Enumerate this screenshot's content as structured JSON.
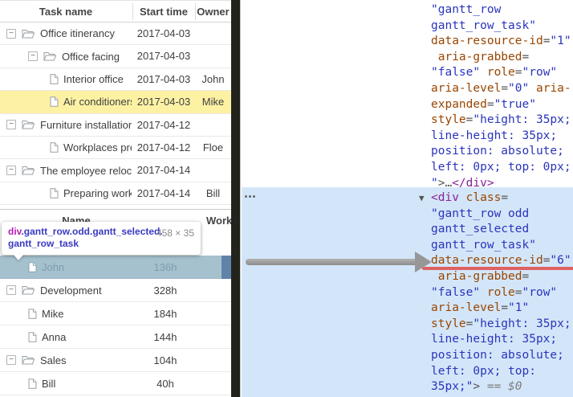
{
  "icons": {
    "collapse_glyph": "−",
    "overflow_marker": "⋯"
  },
  "left_panel": {
    "task_grid": {
      "columns": [
        "Task name",
        "Start time",
        "Owner"
      ],
      "rows": [
        {
          "name": "Office itinerancy",
          "start": "2017-04-03",
          "owner": "",
          "type": "folder",
          "level": 0,
          "highlight": false
        },
        {
          "name": "Office facing",
          "start": "2017-04-03",
          "owner": "",
          "type": "folder",
          "level": 1,
          "highlight": false
        },
        {
          "name": "Interior office",
          "start": "2017-04-03",
          "owner": "John",
          "type": "file",
          "level": 2,
          "highlight": false
        },
        {
          "name": "Air conditioners chec",
          "start": "2017-04-03",
          "owner": "Mike",
          "type": "file",
          "level": 2,
          "highlight": true
        },
        {
          "name": "Furniture installation",
          "start": "2017-04-12",
          "owner": "",
          "type": "folder",
          "level": 0,
          "highlight": false
        },
        {
          "name": "Workplaces preparat",
          "start": "2017-04-12",
          "owner": "Floe",
          "type": "file",
          "level": 1,
          "highlight": false
        },
        {
          "name": "The employee relocatic",
          "start": "2017-04-14",
          "owner": "",
          "type": "folder",
          "level": 0,
          "highlight": false
        },
        {
          "name": "Preparing workplace",
          "start": "2017-04-14",
          "owner": "Bill",
          "type": "file",
          "level": 1,
          "highlight": false
        }
      ]
    },
    "resource_grid": {
      "columns": [
        "Name",
        "Workl"
      ],
      "rows": [
        {
          "name": "John",
          "hours": "136h",
          "type": "file",
          "level": 1,
          "selected": true
        },
        {
          "name": "Development",
          "hours": "328h",
          "type": "folder",
          "level": 0,
          "selected": false
        },
        {
          "name": "Mike",
          "hours": "184h",
          "type": "file",
          "level": 1,
          "selected": false
        },
        {
          "name": "Anna",
          "hours": "144h",
          "type": "file",
          "level": 1,
          "selected": false
        },
        {
          "name": "Sales",
          "hours": "104h",
          "type": "folder",
          "level": 0,
          "selected": false
        },
        {
          "name": "Bill",
          "hours": "40h",
          "type": "file",
          "level": 1,
          "selected": false
        }
      ]
    },
    "tooltip": {
      "selector_tag": "div",
      "selector_classes": ".gantt_row.odd.gantt_selected.gantt_row_task",
      "dimensions": "458 × 35"
    }
  },
  "inspector": {
    "overflow_marker": "⋯",
    "top_lines": [
      {
        "s": [
          {
            "c": "v",
            "t": "\"gantt_row"
          }
        ]
      },
      {
        "s": [
          {
            "c": "v",
            "t": "gantt_row_task\""
          }
        ]
      },
      {
        "s": [
          {
            "c": "a",
            "t": "data-resource-id"
          },
          {
            "c": "p",
            "t": "="
          },
          {
            "c": "v",
            "t": "\"1\""
          }
        ]
      },
      {
        "s": [
          {
            "c": "w",
            "t": " "
          },
          {
            "c": "a",
            "t": "aria-grabbed"
          },
          {
            "c": "p",
            "t": "="
          }
        ]
      },
      {
        "s": [
          {
            "c": "v",
            "t": "\"false\""
          },
          {
            "c": "w",
            "t": " "
          },
          {
            "c": "a",
            "t": "role"
          },
          {
            "c": "p",
            "t": "="
          },
          {
            "c": "v",
            "t": "\"row\""
          }
        ]
      },
      {
        "s": [
          {
            "c": "a",
            "t": "aria-level"
          },
          {
            "c": "p",
            "t": "="
          },
          {
            "c": "v",
            "t": "\"0\""
          },
          {
            "c": "w",
            "t": " "
          },
          {
            "c": "a",
            "t": "aria-"
          }
        ]
      },
      {
        "s": [
          {
            "c": "a",
            "t": "expanded"
          },
          {
            "c": "p",
            "t": "="
          },
          {
            "c": "v",
            "t": "\"true\""
          }
        ]
      },
      {
        "s": [
          {
            "c": "a",
            "t": "style"
          },
          {
            "c": "p",
            "t": "="
          },
          {
            "c": "v",
            "t": "\"height: 35px;"
          }
        ]
      },
      {
        "s": [
          {
            "c": "v",
            "t": "line-height: 35px;"
          }
        ]
      },
      {
        "s": [
          {
            "c": "v",
            "t": "position: absolute;"
          }
        ]
      },
      {
        "s": [
          {
            "c": "v",
            "t": "left: 0px; top: 0px;"
          }
        ]
      },
      {
        "s": [
          {
            "c": "v",
            "t": "\""
          },
          {
            "c": "p",
            "t": ">…"
          },
          {
            "c": "t",
            "t": "</div>"
          }
        ]
      }
    ],
    "selected_lines": [
      {
        "s": [
          {
            "c": "m",
            "t": "▼"
          },
          {
            "c": "t",
            "t": "<div"
          },
          {
            "c": "w",
            "t": " "
          },
          {
            "c": "a",
            "t": "class"
          },
          {
            "c": "p",
            "t": "="
          }
        ]
      },
      {
        "s": [
          {
            "c": "v",
            "t": "\"gantt_row odd"
          }
        ]
      },
      {
        "s": [
          {
            "c": "v",
            "t": "gantt_selected"
          }
        ]
      },
      {
        "s": [
          {
            "c": "v",
            "t": "gantt_row_task\""
          }
        ]
      },
      {
        "u": true,
        "s": [
          {
            "c": "a",
            "t": "data-resource-id"
          },
          {
            "c": "p",
            "t": "="
          },
          {
            "c": "v",
            "t": "\"6\""
          }
        ]
      },
      {
        "s": [
          {
            "c": "w",
            "t": " "
          },
          {
            "c": "a",
            "t": "aria-grabbed"
          },
          {
            "c": "p",
            "t": "="
          }
        ]
      },
      {
        "s": [
          {
            "c": "v",
            "t": "\"false\""
          },
          {
            "c": "w",
            "t": " "
          },
          {
            "c": "a",
            "t": "role"
          },
          {
            "c": "p",
            "t": "="
          },
          {
            "c": "v",
            "t": "\"row\""
          }
        ]
      },
      {
        "s": [
          {
            "c": "a",
            "t": "aria-level"
          },
          {
            "c": "p",
            "t": "="
          },
          {
            "c": "v",
            "t": "\"1\""
          }
        ]
      },
      {
        "s": [
          {
            "c": "a",
            "t": "style"
          },
          {
            "c": "p",
            "t": "="
          },
          {
            "c": "v",
            "t": "\"height: 35px;"
          }
        ]
      },
      {
        "s": [
          {
            "c": "v",
            "t": "line-height: 35px;"
          }
        ]
      },
      {
        "s": [
          {
            "c": "v",
            "t": "position: absolute;"
          }
        ]
      },
      {
        "s": [
          {
            "c": "v",
            "t": "left: 0px; top:"
          }
        ]
      },
      {
        "s": [
          {
            "c": "v",
            "t": "35px;\""
          },
          {
            "c": "p",
            "t": ">"
          },
          {
            "c": "g",
            "t": " == $0"
          }
        ]
      }
    ]
  },
  "colors": {
    "row_highlight_yellow": "#fdf2a4",
    "row_selected_blue": "#a6c1ce",
    "devtools_selection_blue": "#d3e6f9",
    "attr_name": "#994500",
    "attr_value": "#2a35bb",
    "tag": "#882299",
    "underline_red": "#df6161",
    "divider_bar": "#23231d",
    "arrow_gray": "#979797"
  }
}
